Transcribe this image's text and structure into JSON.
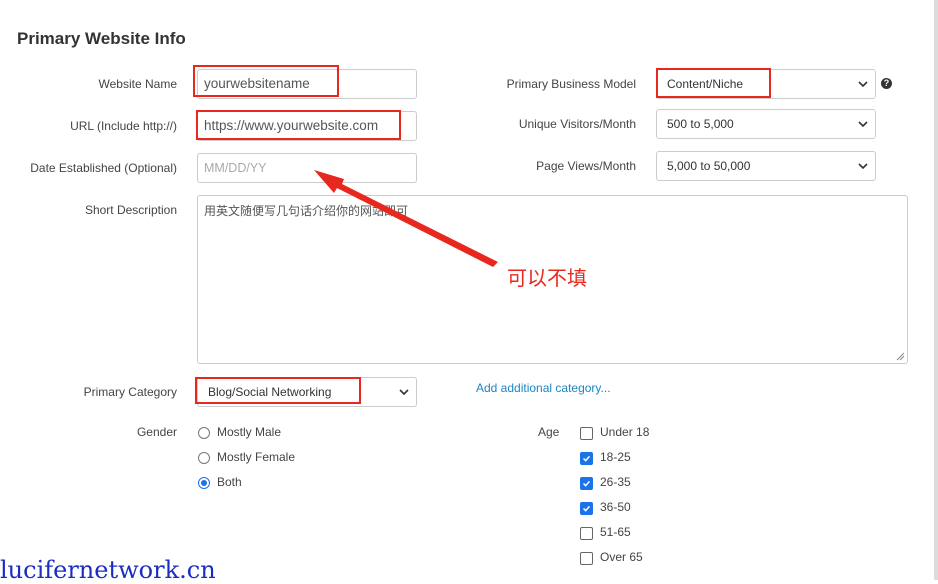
{
  "section": {
    "title": "Primary Website Info"
  },
  "form_left": {
    "website_name": {
      "label": "Website Name",
      "value": "yourwebsitename"
    },
    "url": {
      "label": "URL (Include http://)",
      "value": "https://www.yourwebsite.com"
    },
    "date_established": {
      "label": "Date Established (Optional)",
      "placeholder": "MM/DD/YY"
    },
    "short_description": {
      "label": "Short Description",
      "value": "用英文随便写几句话介绍你的网站即可"
    },
    "primary_category": {
      "label": "Primary Category",
      "selected": "Blog/Social Networking"
    },
    "add_category_link": "Add additional category..."
  },
  "form_right": {
    "business_model": {
      "label": "Primary Business Model",
      "selected": "Content/Niche"
    },
    "unique_visitors": {
      "label": "Unique Visitors/Month",
      "selected": "500 to 5,000"
    },
    "page_views": {
      "label": "Page Views/Month",
      "selected": "5,000 to 50,000"
    }
  },
  "gender": {
    "label": "Gender",
    "options": [
      {
        "label": "Mostly Male",
        "selected": false
      },
      {
        "label": "Mostly Female",
        "selected": false
      },
      {
        "label": "Both",
        "selected": true
      }
    ]
  },
  "age": {
    "label": "Age",
    "options": [
      {
        "label": "Under 18",
        "checked": false
      },
      {
        "label": "18-25",
        "checked": true
      },
      {
        "label": "26-35",
        "checked": true
      },
      {
        "label": "36-50",
        "checked": true
      },
      {
        "label": "51-65",
        "checked": false
      },
      {
        "label": "Over 65",
        "checked": false
      }
    ]
  },
  "annotation": {
    "text": "可以不填"
  },
  "watermark": {
    "text": "lucifernetwork.cn"
  },
  "colors": {
    "accent": "#1a73e8",
    "highlight": "#e8281e",
    "link": "#1a86c8",
    "watermark": "#1b2cc6"
  },
  "icons": {
    "help": "question-circle-icon",
    "dropdown": "chevron-down-icon"
  },
  "help_glyph": "?"
}
